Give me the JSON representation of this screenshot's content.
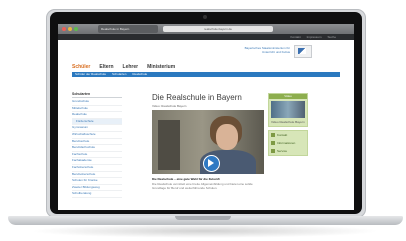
{
  "browser": {
    "tab_title": "Realschule in Bayern",
    "url": "realschule.bayern.de"
  },
  "header": {
    "top_links": [
      "Kontakt",
      "Impressum",
      "Suche"
    ],
    "ministry": "Bayerisches Staatsministerium für Unterricht und Kultus"
  },
  "nav": {
    "items": [
      "Schüler",
      "Eltern",
      "Lehrer",
      "Ministerium"
    ]
  },
  "subnav": {
    "items": [
      "Schüler der Realschule",
      "Schularten",
      "Realschule"
    ]
  },
  "sidebar": {
    "title": "Schularten",
    "items": [
      "Grundschule",
      "Mittelschule",
      "Realschule",
      "Förderschule",
      "Gymnasium",
      "Wirtschaftsschule",
      "Berufsschule",
      "Berufsfachschule",
      "Fachschule",
      "Fachakademie",
      "Fachoberschule",
      "Berufsoberschule",
      "Schulen für Kranke",
      "Zweiter Bildungsweg",
      "Schulberatung"
    ],
    "selected_index": 3
  },
  "main": {
    "title": "Die Realschule in Bayern",
    "subtitle": "Video: Realschule Bayern",
    "caption": "Die Realschule – eine gute Wahl für die Zukunft",
    "body": "Die Realschule vermittelt eine breite Allgemeinbildung und bietet eine solide Grundlage für Beruf und weiterführende Schulen."
  },
  "right": {
    "box_title": "Video",
    "box_label": "Video Realschule Bayern",
    "links": [
      "Kontakt",
      "Informationen",
      "Service"
    ]
  }
}
